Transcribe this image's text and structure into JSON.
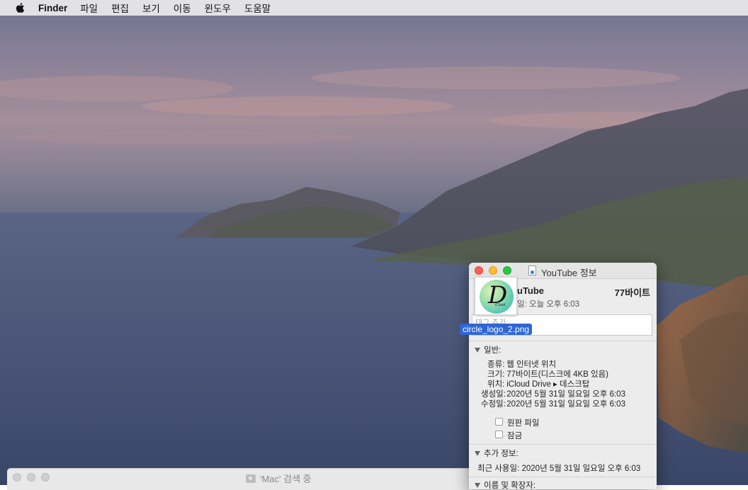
{
  "menubar": {
    "app_name": "Finder",
    "items": [
      "파일",
      "편집",
      "보기",
      "이동",
      "윈도우",
      "도움말"
    ]
  },
  "finder_window": {
    "title": "'Mac' 검색 중"
  },
  "info_window": {
    "title": "YouTube 정보",
    "name": "uTube",
    "size": "77바이트",
    "modified_label": "일:",
    "modified_value": "오늘 오후 6:03",
    "tags_placeholder": "태그 추가...",
    "general_section": "일반:",
    "general": {
      "kind_label": "종류:",
      "kind_value": "웹 인터넷 위치",
      "size_label": "크기:",
      "size_value": "77바이트(디스크에 4KB 있음)",
      "where_label": "위치:",
      "where_value": "iCloud Drive ▸ 데스크탑",
      "created_label": "생성일:",
      "created_value": "2020년 5월 31일 일요일 오후 6:03",
      "modified_label": "수정일:",
      "modified_value": "2020년 5월 31일 일요일 오후 6:03"
    },
    "checkboxes": {
      "stationery": "원판 파일",
      "locked": "잠금"
    },
    "more_info_section": "추가 정보:",
    "last_opened_label": "최근 사용일:",
    "last_opened_value": "2020년 5월 31일 일요일 오후 6:03",
    "name_ext_section": "이름 및 확장자:"
  },
  "drag_item": {
    "filename": "circle_logo_2.png",
    "logo_letter": "D",
    "logo_text": "iCloud"
  },
  "colors": {
    "selection": "#2f66d6",
    "close": "#fe5f57",
    "minimize": "#febc2e",
    "zoom": "#28c840"
  }
}
